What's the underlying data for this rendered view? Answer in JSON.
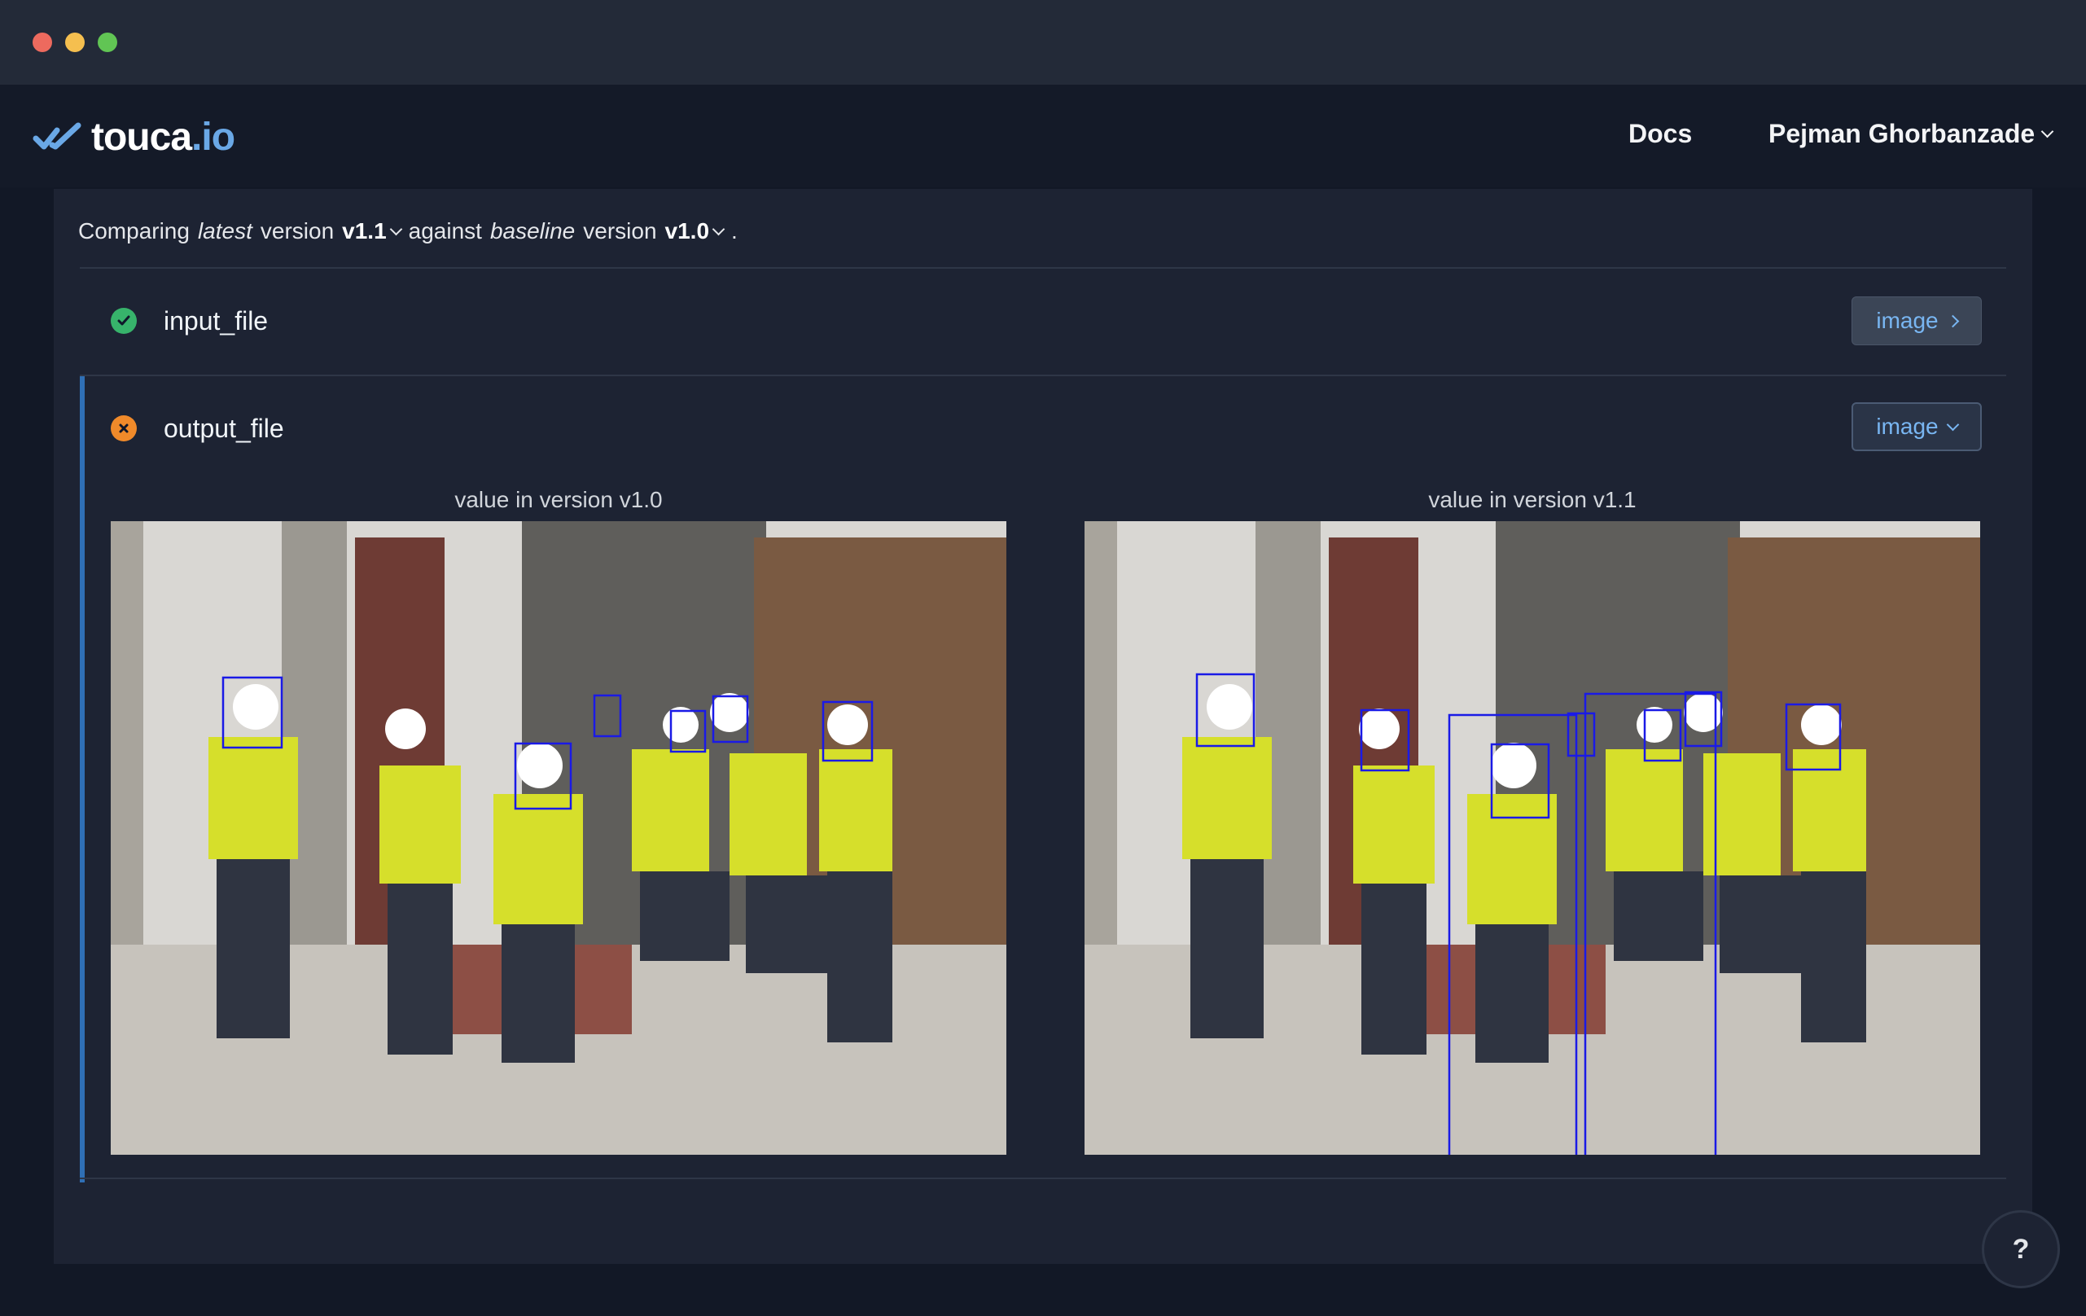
{
  "brand": {
    "name_main": "touca",
    "name_suffix": ".io"
  },
  "nav": {
    "docs": "Docs",
    "user": "Pejman Ghorbanzade"
  },
  "comparison": {
    "prefix": "Comparing",
    "latest_word": "latest",
    "version_word": "version",
    "latest_version": "v1.1",
    "against": "against",
    "baseline_word": "baseline",
    "version_word2": "version",
    "baseline_version": "v1.0",
    "end": "."
  },
  "results": [
    {
      "name": "input_file",
      "status": "passed",
      "type": "image",
      "expanded": false
    },
    {
      "name": "output_file",
      "status": "failed",
      "type": "image",
      "expanded": true
    }
  ],
  "captions": {
    "left": "value in version v1.0",
    "right": "value in version v1.1"
  },
  "help": "?",
  "colors": {
    "accent": "#2f6fb5",
    "ok": "#37b36b",
    "fail": "#f08a2a",
    "link": "#79b6f2"
  }
}
